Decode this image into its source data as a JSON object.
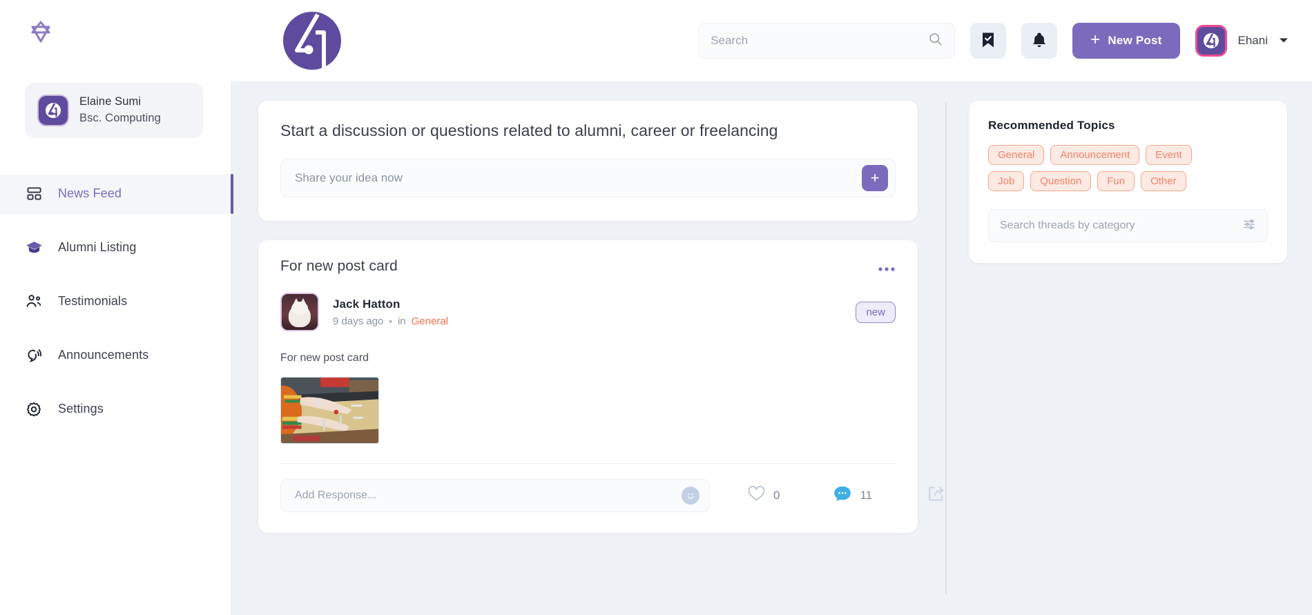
{
  "brand": {
    "logo_icon": "star-outline-logo",
    "header_logo_icon": "circle-4-logo"
  },
  "profile": {
    "avatar_icon": "app-avatar",
    "name": "Elaine Sumi",
    "subtitle": "Bsc. Computing"
  },
  "sidebar": {
    "items": [
      {
        "label": "News Feed",
        "icon": "dashboard-icon",
        "active": true
      },
      {
        "label": "Alumni Listing",
        "icon": "graduation-cap-icon",
        "active": false
      },
      {
        "label": "Testimonials",
        "icon": "users-icon",
        "active": false
      },
      {
        "label": "Announcements",
        "icon": "megaphone-bell-icon",
        "active": false
      },
      {
        "label": "Settings",
        "icon": "gear-icon",
        "active": false
      }
    ]
  },
  "topbar": {
    "search": {
      "value": "",
      "placeholder": "Search",
      "icon": "search-icon"
    },
    "bookmark_icon": "bookmark-check-icon",
    "notification_icon": "bell-icon",
    "new_post_label": "New Post",
    "new_post_plus": "+",
    "user": {
      "name": "Ehani",
      "avatar_icon": "user-avatar",
      "chevron_icon": "chevron-down-icon"
    }
  },
  "composer": {
    "title": "Start a discussion or questions related to alumni, career or freelancing",
    "input": {
      "value": "",
      "placeholder": "Share your idea now"
    },
    "add_button_label": "+",
    "add_button_icon": "plus-icon"
  },
  "post": {
    "title": "For new post card",
    "menu_icon": "ellipsis-horizontal-icon",
    "author": {
      "name": "Jack Hatton",
      "avatar_icon": "cat-avatar"
    },
    "time": "9 days ago",
    "separator": "•",
    "in_word": "in",
    "category": "General",
    "badge": "new",
    "body": "For new post card",
    "image_alt": "post-attachment-photo",
    "response": {
      "value": "",
      "placeholder": "Add Response...",
      "emoji_icon": "smiley-icon"
    },
    "actions": {
      "like": {
        "icon": "heart-icon",
        "count": "0"
      },
      "comment": {
        "icon": "comment-bubble-icon",
        "count": "11"
      },
      "share": {
        "icon": "share-arrow-icon"
      }
    }
  },
  "topics": {
    "title": "Recommended Topics",
    "tags": [
      "General",
      "Announcement",
      "Event",
      "Job",
      "Question",
      "Fun",
      "Other"
    ],
    "search": {
      "value": "",
      "placeholder": "Search threads by category",
      "icon": "filter-sliders-icon"
    }
  },
  "colors": {
    "accent_purple": "#7c6bbd",
    "accent_purple_dark": "#5e4b9e",
    "tag_orange": "#f0826a",
    "tag_bg": "#fdeae3",
    "category_orange": "#f0714e",
    "comment_blue": "#3eaee8",
    "page_bg": "#eef1f5",
    "avatar_border_pink": "#ec4c94"
  }
}
